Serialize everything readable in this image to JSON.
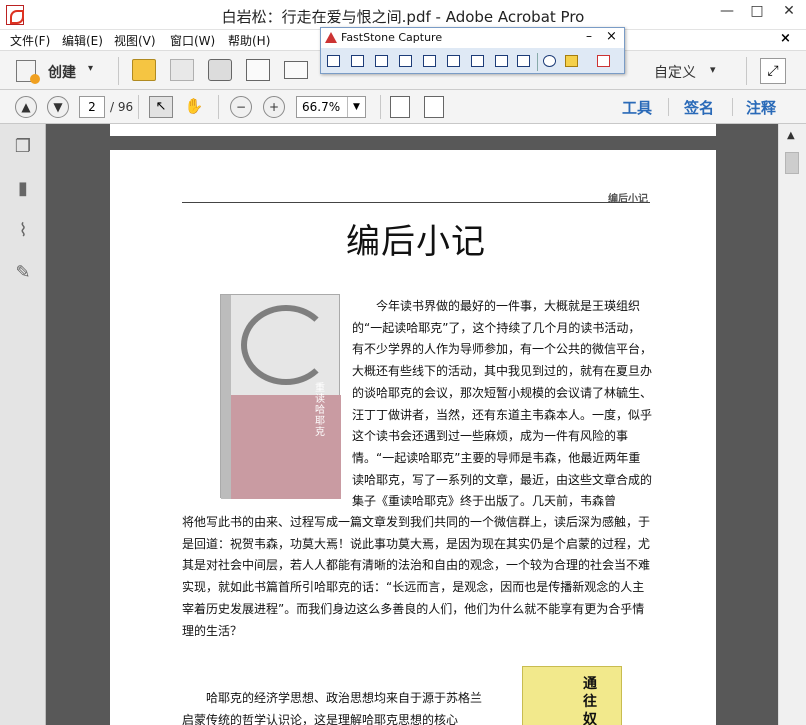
{
  "window": {
    "title": "白岩松：行走在爱与恨之间.pdf - Adobe Acrobat Pro",
    "minimize": "—",
    "maximize": "□",
    "close": "✕"
  },
  "menu": {
    "items": [
      "文件(F)",
      "编辑(E)",
      "视图(V)",
      "窗口(W)",
      "帮助(H)"
    ],
    "close": "×"
  },
  "faststone": {
    "title": "FastStone Capture",
    "minimize": "–",
    "close": "×"
  },
  "toolbar": {
    "create_label": "创建",
    "custom_label": "自定义",
    "caret": "▾"
  },
  "nav": {
    "current_page": "2",
    "total_pages": "/ 96",
    "zoom": "66.7%",
    "tools_label": "工具",
    "sign_label": "签名",
    "comment_label": "注释"
  },
  "doc": {
    "running_head": "编后小记",
    "title": "编后小记",
    "book1_title": "重读哈耶克",
    "book2_title": "通往奴",
    "para1": "　　今年读书界做的最好的一件事，大概就是王瑛组织的“一起读哈耶克”了，这个持续了几个月的读书活动，有不少学界的人作为导师参加，有一个公共的微信平台，大概还有些线下的活动，其中我见到过的，就有在夏旦办的谈哈耶克的会议，那次短暂小规模的会议请了林毓生、汪丁丁做讲者，当然，还有东道主韦森本人。一度，似乎这个读书会还遇到过一些麻烦，成为一件有风险的事情。“一起读哈耶克”主要的导师是韦森，他最近两年重读哈耶克，写了一系列的文章，最近，由这些文章合成的集子《重读哈耶克》终于出版了。几天前，韦森曾",
    "para2": "将他写此书的由来、过程写成一篇文章发到我们共同的一个微信群上，读后深为感触，于是回道：祝贺韦森，功莫大焉！说此事功莫大焉，是因为现在其实仍是个启蒙的过程，尤其是对社会中间层，若人人都能有清晰的法治和自由的观念，一个较为合理的社会当不难实现，就如此书篇首所引哈耶克的话：“长远而言，是观念，因而也是传播新观念的人主宰着历史发展进程”。而我们身边这么多善良的人们，他们为什么就不能享有更为合乎情理的生活？",
    "para3": "　　哈耶克的经济学思想、政治思想均来自于源于苏格兰启蒙传统的哲学认识论，这是理解哈耶克思想的核心"
  },
  "colors": {
    "accent": "#2a6ab8",
    "doc_bg": "#585858",
    "cover_pink": "#c99ba2",
    "cover2_yellow": "#f2e98c"
  },
  "icons": [
    "pdf-icon",
    "create-icon",
    "folder-icon",
    "save-icon",
    "print-icon",
    "edit-icon",
    "mail-icon",
    "expand-icon",
    "page-up-icon",
    "page-down-icon",
    "select-icon",
    "hand-icon",
    "zoom-out-icon",
    "zoom-in-icon",
    "fit-page-icon",
    "fit-width-icon",
    "pages-icon",
    "bookmark-icon",
    "attachment-icon",
    "signature-icon"
  ]
}
